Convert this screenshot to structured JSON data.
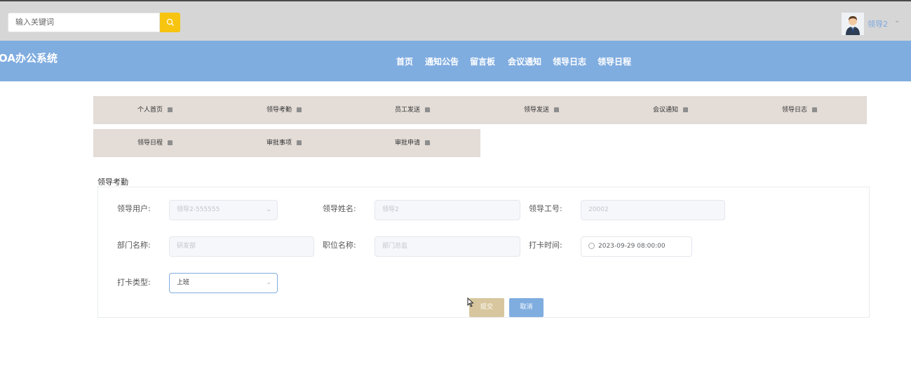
{
  "header": {
    "search": {
      "placeholder": "输入关键词"
    },
    "user": {
      "name": "领导2",
      "caret": "⌄"
    }
  },
  "navbar": {
    "brand": "OA办公系统",
    "items": [
      "首页",
      "通知公告",
      "留言板",
      "会议通知",
      "领导日志",
      "领导日程"
    ]
  },
  "menu": {
    "row1": [
      "个人首页",
      "领导考勤",
      "员工发送",
      "领导发送",
      "会议通知",
      "领导日志"
    ],
    "row2": [
      "领导日程",
      "审批事项",
      "审批申请"
    ]
  },
  "form": {
    "title": "领导考勤",
    "fields": {
      "user": {
        "label": "领导用户:",
        "value": "领导2-555555"
      },
      "name": {
        "label": "领导姓名:",
        "value": "领导2"
      },
      "id": {
        "label": "领导工号:",
        "value": "20002"
      },
      "dept": {
        "label": "部门名称:",
        "value": "研发部"
      },
      "position": {
        "label": "职位名称:",
        "value": "部门总监"
      },
      "time": {
        "label": "打卡时间:",
        "value": "2023-09-29 08:00:00"
      },
      "type": {
        "label": "打卡类型:",
        "value": "上班"
      }
    },
    "buttons": {
      "submit": "提交",
      "cancel": "取消"
    }
  },
  "colors": {
    "topbar": "#d6d6d6",
    "navbar": "#80ade0",
    "search_button": "#f7c40f",
    "menu_bg": "#e3dcd7",
    "submit_button": "#d8c79e",
    "cancel_button": "#80ade0"
  },
  "icons": {
    "search": "search-icon",
    "avatar": "avatar",
    "menu": "home-icon",
    "clock": "clock-icon",
    "cursor": "cursor-icon"
  }
}
